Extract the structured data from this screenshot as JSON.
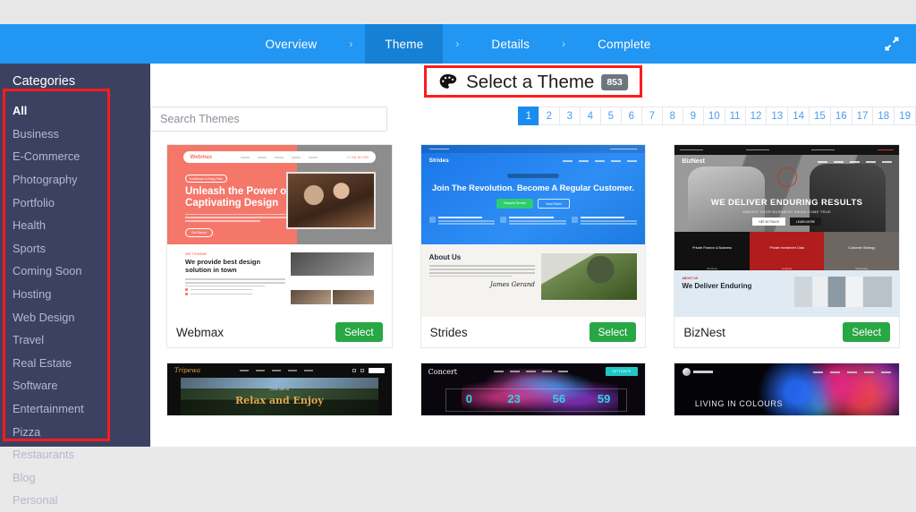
{
  "wizard": {
    "steps": [
      {
        "label": "Overview",
        "active": false
      },
      {
        "label": "Theme",
        "active": true
      },
      {
        "label": "Details",
        "active": false
      },
      {
        "label": "Complete",
        "active": false
      }
    ],
    "separator": "›",
    "expand_icon": "compress-arrows-icon",
    "accent_color": "#2196f3",
    "active_step_color": "#1580d4"
  },
  "sidebar": {
    "title": "Categories",
    "background_color": "#3c4161",
    "items": [
      {
        "label": "All",
        "active": true
      },
      {
        "label": "Business",
        "active": false
      },
      {
        "label": "E-Commerce",
        "active": false
      },
      {
        "label": "Photography",
        "active": false
      },
      {
        "label": "Portfolio",
        "active": false
      },
      {
        "label": "Health",
        "active": false
      },
      {
        "label": "Sports",
        "active": false
      },
      {
        "label": "Coming Soon",
        "active": false
      },
      {
        "label": "Hosting",
        "active": false
      },
      {
        "label": "Web Design",
        "active": false
      },
      {
        "label": "Travel",
        "active": false
      },
      {
        "label": "Real Estate",
        "active": false
      },
      {
        "label": "Software",
        "active": false
      },
      {
        "label": "Entertainment",
        "active": false
      },
      {
        "label": "Pizza",
        "active": false
      },
      {
        "label": "Restaurants",
        "active": false
      },
      {
        "label": "Blog",
        "active": false
      },
      {
        "label": "Personal",
        "active": false
      }
    ]
  },
  "main": {
    "title": "Select a Theme",
    "title_icon": "palette-icon",
    "count_badge": "853",
    "search": {
      "placeholder": "Search Themes",
      "value": ""
    },
    "pagination": {
      "pages": [
        "1",
        "2",
        "3",
        "4",
        "5",
        "6",
        "7",
        "8",
        "9",
        "10",
        "11",
        "12",
        "13",
        "14",
        "15",
        "16",
        "17",
        "18",
        "19"
      ],
      "active": "1",
      "active_color": "#1a8cf0"
    },
    "select_label": "Select",
    "select_color": "#28a745",
    "themes": [
      {
        "name": "Webmax",
        "preview": {
          "logo": "Webmax",
          "tagline": "Excellence in Every Pixel",
          "headline": "Unleash the Power of Captivating Design",
          "cta": "Get Started",
          "phone": "+1 234 567 890",
          "section_kicker": "GET TO KNOW",
          "section_heading": "We provide best design solution in town"
        }
      },
      {
        "name": "Strides",
        "preview": {
          "logo": "Strides",
          "headline": "Join The Revolution. Become A Regular Customer.",
          "primary_cta": "Request Service",
          "secondary_cta": "View Prices",
          "features": [
            "Unlimited Possibilities",
            "Personal Service",
            "Cutting-edge Built"
          ],
          "section_heading": "About Us",
          "signature": "James Gerand"
        }
      },
      {
        "name": "BizNest",
        "preview": {
          "logo": "BizNest",
          "headline": "WE DELIVER  ENDURING RESULTS",
          "subheadline": "MAKING YOUR BUSINESS  IDEAS COME TRUE",
          "primary_cta": "GET IN TOUCH",
          "secondary_cta": "LEARN MORE",
          "tiles": [
            {
              "title": "Private Finance & Business",
              "subtitle": "Services"
            },
            {
              "title": "Private Investment Data",
              "subtitle": "Analysis"
            },
            {
              "title": "Customer Strategy",
              "subtitle": "Marketing"
            }
          ],
          "section_kicker": "ABOUT US",
          "section_heading": "We Deliver Enduring"
        }
      },
      {
        "name": "Tripewa",
        "preview": {
          "logo": "Tripewa",
          "caption": "Come with us",
          "headline": "Relax and Enjoy",
          "nav_cta": "Book Now"
        }
      },
      {
        "name": "Concert",
        "preview": {
          "logo": "Concert",
          "nav_cta": "GET TICKETS",
          "countdown": [
            "0",
            "23",
            "56",
            "59"
          ]
        }
      },
      {
        "name": "Living in Colours",
        "preview": {
          "logo": "Color Studio",
          "headline": "LIVING IN COLOURS"
        }
      }
    ]
  },
  "annotations": {
    "color": "#fc1c1c",
    "boxes": [
      "sidebar-category-list",
      "select-a-theme-title"
    ]
  }
}
